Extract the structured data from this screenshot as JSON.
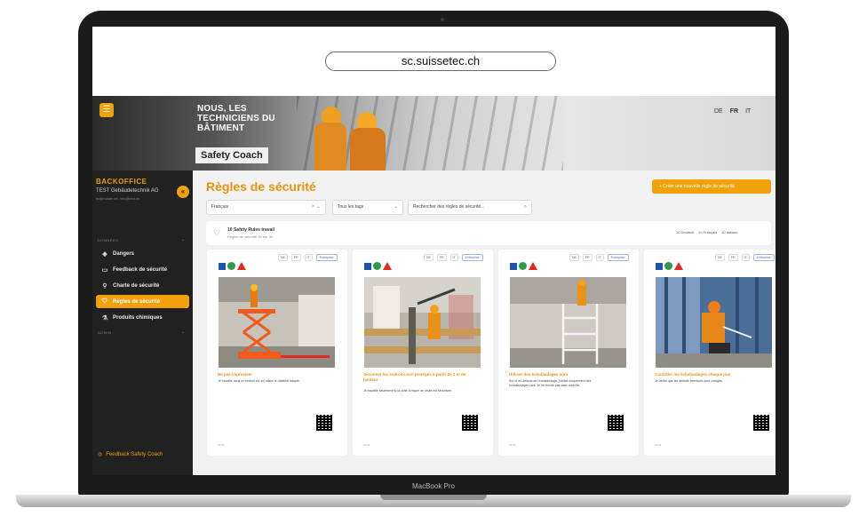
{
  "browser": {
    "url": "sc.suissetec.ch"
  },
  "device": {
    "label": "MacBook Pro"
  },
  "hero": {
    "slogan_line1": "NOUS, LES",
    "slogan_line2": "TECHNICIENS DU BÂTIMENT",
    "app_name": "Safety Coach",
    "languages": [
      "DE",
      "FR",
      "IT"
    ],
    "active_language": "FR"
  },
  "sidebar": {
    "title": "BACKOFFICE",
    "company": "TEST Gebäudetechnik AG",
    "email": "m@muster.ch, info@test.ch",
    "section_donnees": "DONNÉES",
    "section_admin": "ADMIN",
    "items": [
      {
        "label": "Dangers",
        "icon": "dangers-icon"
      },
      {
        "label": "Feedback de sécurité",
        "icon": "feedback-icon"
      },
      {
        "label": "Charte de sécurité",
        "icon": "charter-icon"
      },
      {
        "label": "Règles de sécurité",
        "icon": "shield-icon",
        "active": true
      },
      {
        "label": "Produits chimiques",
        "icon": "flask-icon"
      }
    ],
    "footer_feedback": "Feedback Safety Coach"
  },
  "main": {
    "title": "Règles de sécurité",
    "create_button": "+ Créer une nouvelle règle de sécurité",
    "filters": {
      "language_value": "Français",
      "tags_value": "Tous les tags",
      "search_placeholder": "Rechercher des règles de sécurité..."
    },
    "rules_set": {
      "title": "10 Safety Rules travail",
      "subtitle": "Règles de sécurité 30 sur 30",
      "counts": [
        "10 Deutsch",
        "10 Français",
        "10 Italiano"
      ]
    },
    "card_tags": [
      "DE",
      "FR",
      "IT"
    ],
    "card_category": "Entreprise",
    "cards": [
      {
        "title": "Ne pas improviser",
        "desc": "Je travaille dans un endroit sûr et j'utilise le matériel adapté.",
        "date": "10.01"
      },
      {
        "title": "Sécuriser les endroits non protégés à partir de 2 m de hauteur",
        "desc": "Je travaille seulement si la zone à risque de chute est sécurisée.",
        "date": "10.01"
      },
      {
        "title": "Utiliser des échafaudages sûrs",
        "desc": "Sur et au-dessus de l'échafaudage, j'utilise uniquement des échafaudages sûrs. Je ne monte pas sans contrôle.",
        "date": "10.01"
      },
      {
        "title": "Contrôler les échafaudages chaque jour",
        "desc": "Je vérifie que les défauts éventuels sont corrigés.",
        "date": "10.01"
      }
    ]
  }
}
